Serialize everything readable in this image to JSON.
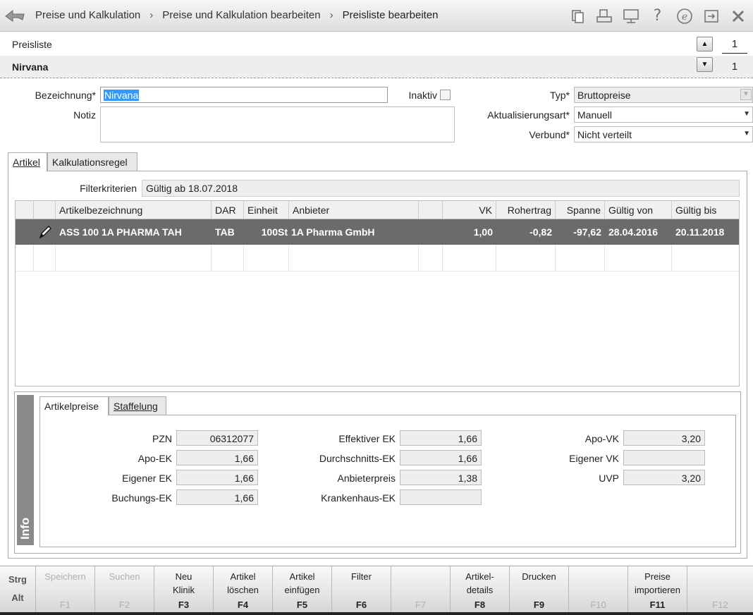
{
  "titlebar": {
    "crumbs": [
      "Preise und Kalkulation",
      "Preise und Kalkulation bearbeiten",
      "Preisliste bearbeiten"
    ],
    "icons": [
      "document-icon",
      "print-icon",
      "monitor-icon",
      "help-icon",
      "e-icon",
      "export-icon",
      "close-icon"
    ]
  },
  "header": {
    "label": "Preisliste",
    "name": "Nirvana",
    "counter_top": "1",
    "counter_bottom": "1"
  },
  "form": {
    "bezeichnung_label": "Bezeichnung*",
    "bezeichnung_value": "Nirvana",
    "notiz_label": "Notiz",
    "notiz_value": "",
    "inaktiv_label": "Inaktiv",
    "typ_label": "Typ*",
    "typ_value": "Bruttopreise",
    "aktualisierung_label": "Aktualisierungsart*",
    "aktualisierung_value": "Manuell",
    "verbund_label": "Verbund*",
    "verbund_value": "Nicht verteilt"
  },
  "tabs": {
    "artikel": "Artikel",
    "kalkulationsregel": "Kalkulationsregel"
  },
  "filter": {
    "label": "Filterkriterien",
    "value": "Gültig ab 18.07.2018"
  },
  "table": {
    "columns": [
      "Artikelbezeichnung",
      "DAR",
      "Einheit",
      "Anbieter",
      "VK",
      "Rohertrag",
      "Spanne",
      "Gültig von",
      "Gültig bis"
    ],
    "rows": [
      {
        "artikel": "ASS 100 1A PHARMA TAH",
        "dar": "TAB",
        "einheit": "100St",
        "anbieter": "1A Pharma GmbH",
        "vk": "1,00",
        "rohertrag": "-0,82",
        "spanne": "-97,62",
        "von": "28.04.2016",
        "bis": "20.11.2018"
      }
    ]
  },
  "info": {
    "sidebar": "Info",
    "tab_artikelpreise": "Artikelpreise",
    "tab_staffelung": "Staffelung",
    "pzn_label": "PZN",
    "pzn": "06312077",
    "apoek_label": "Apo-EK",
    "apoek": "1,66",
    "eigenerek_label": "Eigener EK",
    "eigenerek": "1,66",
    "buchungsek_label": "Buchungs-EK",
    "buchungsek": "1,66",
    "effektivek_label": "Effektiver EK",
    "effektivek": "1,66",
    "durchschnittsek_label": "Durchschnitts-EK",
    "durchschnittsek": "1,66",
    "anbieterpreis_label": "Anbieterpreis",
    "anbieterpreis": "1,38",
    "krankenhausek_label": "Krankenhaus-EK",
    "krankenhausek": "",
    "apovk_label": "Apo-VK",
    "apovk": "3,20",
    "eigenervk_label": "Eigener VK",
    "eigenervk": "",
    "uvp_label": "UVP",
    "uvp": "3,20"
  },
  "fkeys": {
    "strg": "Strg",
    "alt": "Alt",
    "f1": {
      "l1": "Speichern",
      "l2": "",
      "k": "F1"
    },
    "f2": {
      "l1": "Suchen",
      "l2": "",
      "k": "F2"
    },
    "f3": {
      "l1": "Neu",
      "l2": "Klinik",
      "k": "F3"
    },
    "f4": {
      "l1": "Artikel",
      "l2": "löschen",
      "k": "F4"
    },
    "f5": {
      "l1": "Artikel",
      "l2": "einfügen",
      "k": "F5"
    },
    "f6": {
      "l1": "Filter",
      "l2": "",
      "k": "F6"
    },
    "f7": {
      "l1": "",
      "l2": "",
      "k": "F7"
    },
    "f8": {
      "l1": "Artikel-",
      "l2": "details",
      "k": "F8"
    },
    "f9": {
      "l1": "Drucken",
      "l2": "",
      "k": "F9"
    },
    "f10": {
      "l1": "",
      "l2": "",
      "k": "F10"
    },
    "f11": {
      "l1": "Preise",
      "l2": "importieren",
      "k": "F11"
    },
    "f12": {
      "l1": "",
      "l2": "",
      "k": "F12"
    }
  }
}
